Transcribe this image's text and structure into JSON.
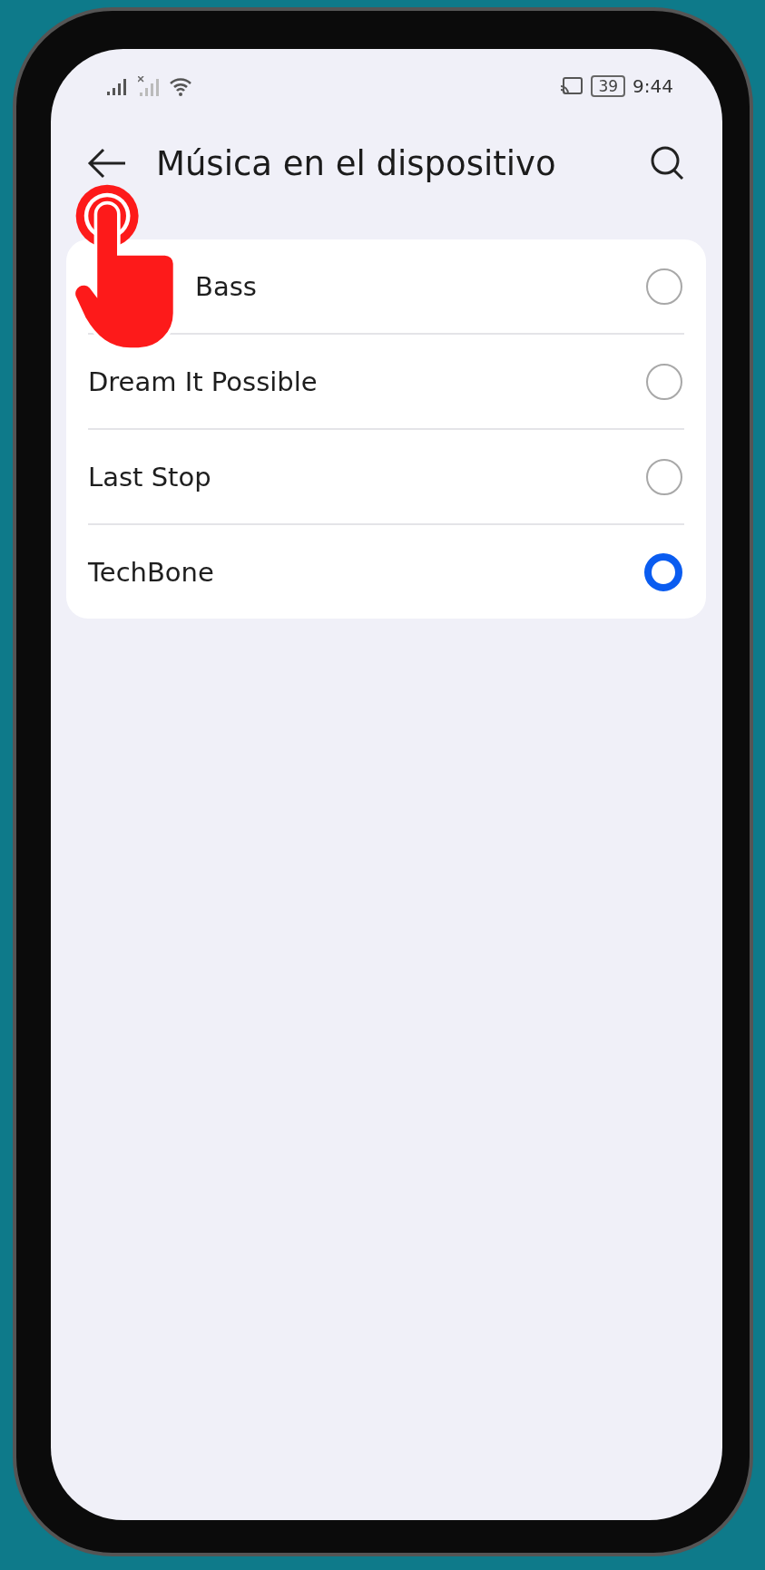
{
  "status_bar": {
    "battery": "39",
    "time": "9:44"
  },
  "header": {
    "title": "Música en el dispositivo"
  },
  "songs": [
    {
      "label": "Bass",
      "selected": false,
      "covered_by_tap_hint": true
    },
    {
      "label": "Dream It Possible",
      "selected": false
    },
    {
      "label": "Last Stop",
      "selected": false
    },
    {
      "label": "TechBone",
      "selected": true
    }
  ]
}
